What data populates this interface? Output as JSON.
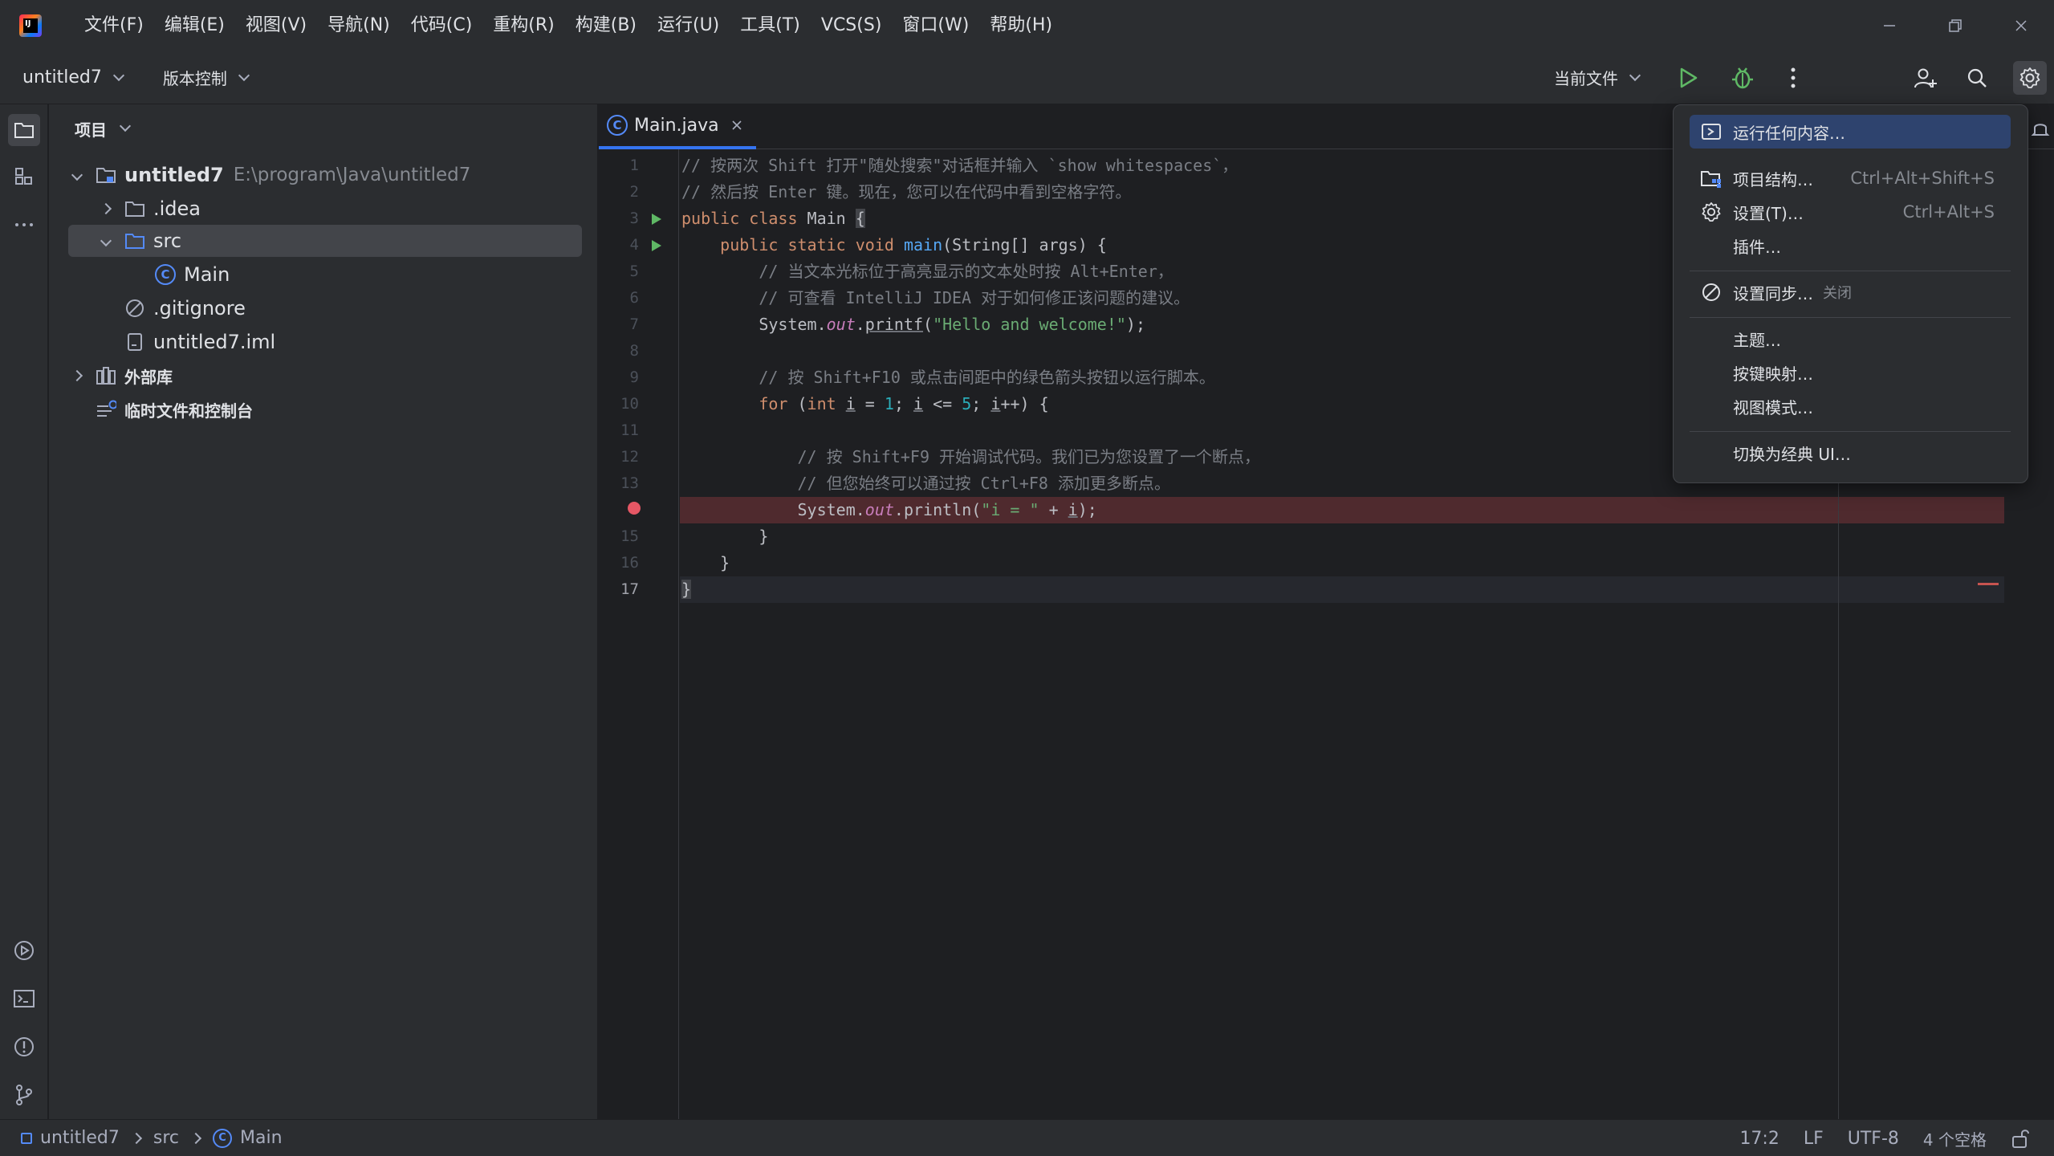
{
  "menubar": {
    "items": [
      "文件(F)",
      "编辑(E)",
      "视图(V)",
      "导航(N)",
      "代码(C)",
      "重构(R)",
      "构建(B)",
      "运行(U)",
      "工具(T)",
      "VCS(S)",
      "窗口(W)",
      "帮助(H)"
    ]
  },
  "toolbar": {
    "project_name": "untitled7",
    "vcs_label": "版本控制",
    "run_config": "当前文件"
  },
  "project_panel": {
    "header": "项目",
    "root_name": "untitled7",
    "root_path": "E:\\program\\Java\\untitled7",
    "idea_folder": ".idea",
    "src_folder": "src",
    "main_class": "Main",
    "gitignore": ".gitignore",
    "iml_file": "untitled7.iml",
    "external_libs": "外部库",
    "scratches": "临时文件和控制台"
  },
  "editor": {
    "tab_name": "Main.java",
    "line_numbers": [
      "1",
      "2",
      "3",
      "4",
      "5",
      "6",
      "7",
      "8",
      "9",
      "10",
      "11",
      "12",
      "13",
      "",
      "15",
      "16",
      "17"
    ],
    "code": {
      "l1": "// 按两次 Shift 打开\"随处搜索\"对话框并输入 `show whitespaces`，",
      "l2": "// 然后按 Enter 键。现在，您可以在代码中看到空格字符。",
      "l3_kw": "public class",
      "l3_name": " Main ",
      "l3_brace": "{",
      "l4_kw": "public static void",
      "l4_fn": "main",
      "l4_rest": "(String[] args) {",
      "l5": "// 当文本光标位于高亮显示的文本处时按 Alt+Enter，",
      "l6": "// 可查看 IntelliJ IDEA 对于如何修正该问题的建议。",
      "l7_a": "System.",
      "l7_out": "out",
      "l7_b": ".",
      "l7_fn": "printf",
      "l7_c": "(",
      "l7_str": "\"Hello and welcome!\"",
      "l7_d": ");",
      "l9": "// 按 Shift+F10 或点击间距中的绿色箭头按钮以运行脚本。",
      "l10_for": "for",
      "l10_a": " (",
      "l10_int": "int",
      "l10_b": " ",
      "l10_i1": "i",
      "l10_c": " = ",
      "l10_n1": "1",
      "l10_d": "; ",
      "l10_i2": "i",
      "l10_e": " <= ",
      "l10_n2": "5",
      "l10_f": "; ",
      "l10_i3": "i",
      "l10_g": "++) {",
      "l12": "// 按 Shift+F9 开始调试代码。我们已为您设置了一个断点，",
      "l13": "// 但您始终可以通过按 Ctrl+F8 添加更多断点。",
      "l14_a": "System.",
      "l14_out": "out",
      "l14_b": ".println(",
      "l14_str": "\"i = \"",
      "l14_c": " + ",
      "l14_i": "i",
      "l14_d": ");",
      "l15": "}",
      "l16": "}",
      "l17": "}"
    }
  },
  "statusbar": {
    "crumb_project": "untitled7",
    "crumb_src": "src",
    "crumb_main": "Main",
    "position": "17:2",
    "line_sep": "LF",
    "encoding": "UTF-8",
    "indent": "4 个空格"
  },
  "popup_menu": {
    "run_anything": "运行任何内容…",
    "project_structure": "项目结构…",
    "project_structure_shortcut": "Ctrl+Alt+Shift+S",
    "settings": "设置(T)…",
    "settings_shortcut": "Ctrl+Alt+S",
    "plugins": "插件…",
    "settings_sync": "设置同步…",
    "settings_sync_state": "关闭",
    "theme": "主题…",
    "keymap": "按键映射…",
    "view_mode": "视图模式…",
    "classic_ui": "切换为经典 UI…"
  },
  "colors": {
    "accent": "#3574f0",
    "run_green": "#5fb865",
    "breakpoint_red": "#e55765"
  }
}
